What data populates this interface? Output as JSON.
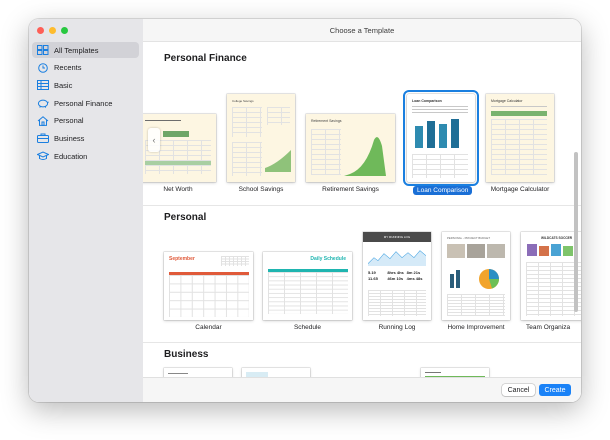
{
  "window": {
    "title": "Choose a Template"
  },
  "sidebar": {
    "items": [
      {
        "label": "All Templates",
        "icon": "grid-icon",
        "active": true
      },
      {
        "label": "Recents",
        "icon": "clock-icon"
      },
      {
        "label": "Basic",
        "icon": "table-icon"
      },
      {
        "label": "Personal Finance",
        "icon": "piggy-bank-icon"
      },
      {
        "label": "Personal",
        "icon": "house-icon"
      },
      {
        "label": "Business",
        "icon": "briefcase-icon"
      },
      {
        "label": "Education",
        "icon": "graduation-cap-icon"
      }
    ]
  },
  "sections": {
    "personal_finance": {
      "title": "Personal Finance",
      "templates": [
        "Net Worth",
        "School Savings",
        "Retirement Savings",
        "Loan Comparison",
        "Mortgage Calculator"
      ],
      "selected": "Loan Comparison"
    },
    "personal": {
      "title": "Personal",
      "templates": [
        "Calendar",
        "Schedule",
        "Running Log",
        "Home Improvement",
        "Team Organiza"
      ]
    },
    "business": {
      "title": "Business"
    }
  },
  "thumb_text": {
    "calendar_month": "September",
    "schedule_title": "Daily Schedule",
    "school_savings": "College Savings",
    "retirement": "Retirement Savings",
    "loan": "Loan Comparison",
    "mortgage": "Mortgage Calculator",
    "running_header": "MY RUNNING LOG",
    "running_stats": [
      "5.19",
      "8hrs 4hs",
      "8m 21s",
      "11.65",
      "46m 10s",
      "4ms 48s"
    ],
    "home_title": "PERSONAL - PROJECT BUDGET",
    "team_title": "WILDCATS SOCCER"
  },
  "footer": {
    "cancel_label": "Cancel",
    "create_label": "Create"
  },
  "colors": {
    "accent": "#1a82f7",
    "selection": "#1a6fd6",
    "calendar_red": "#e05a3a",
    "schedule_teal": "#1fb5b0",
    "loan_teal": "#2e8bb0"
  }
}
